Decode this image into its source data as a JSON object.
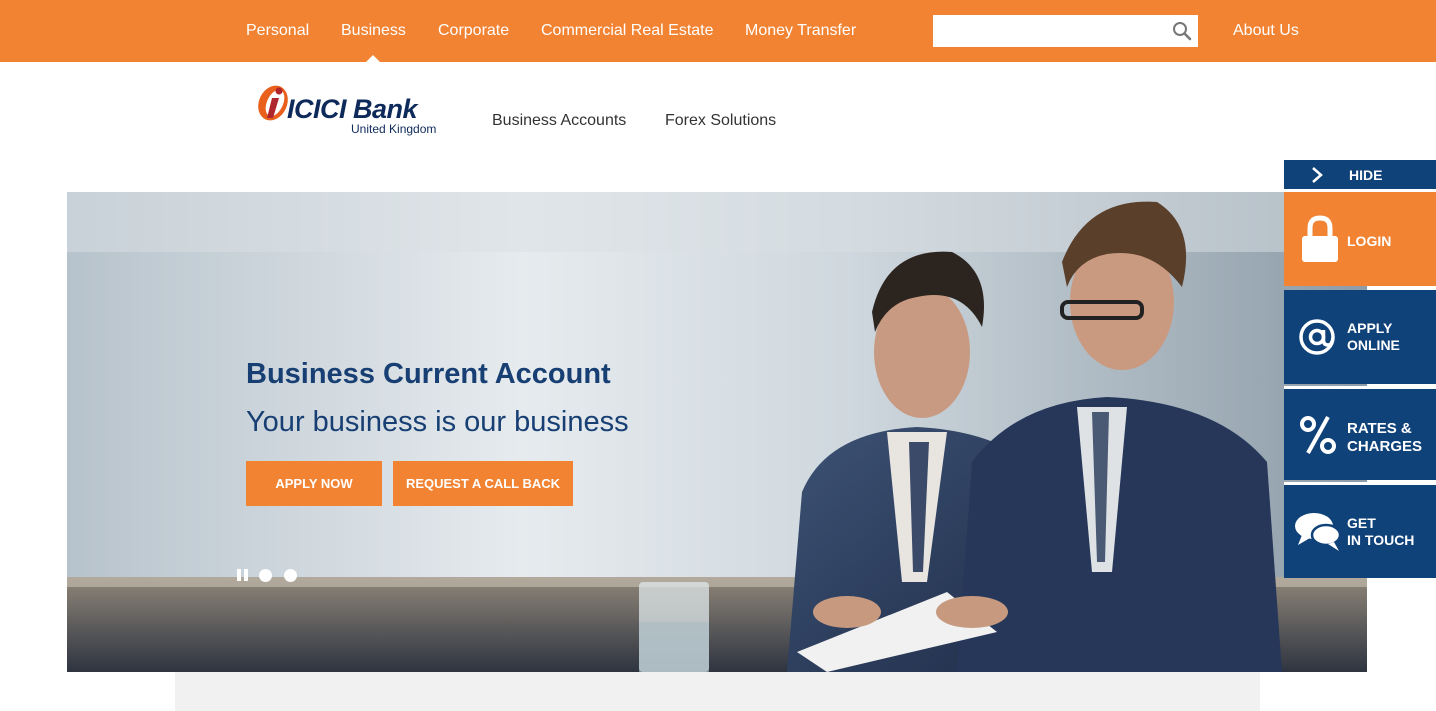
{
  "topnav": {
    "items": [
      {
        "label": "Personal"
      },
      {
        "label": "Business"
      },
      {
        "label": "Corporate"
      },
      {
        "label": "Commercial Real Estate"
      },
      {
        "label": "Money Transfer"
      }
    ],
    "active": "Business",
    "about": "About Us",
    "search_value": ""
  },
  "logo": {
    "brand": "ICICI Bank",
    "sub": "United Kingdom"
  },
  "subnav": {
    "items": [
      {
        "label": "Business Accounts"
      },
      {
        "label": "Forex Solutions"
      }
    ]
  },
  "hero": {
    "title": "Business Current Account",
    "subtitle": "Your business is our business",
    "apply_label": "APPLY NOW",
    "callback_label": "REQUEST A CALL BACK"
  },
  "side_panel": {
    "hide_label": "HIDE",
    "login": "LOGIN",
    "apply_line1": "APPLY",
    "apply_line2": "ONLINE",
    "rates_line1": "RATES &",
    "rates_line2": "CHARGES",
    "touch_line1": "GET",
    "touch_line2": "IN TOUCH"
  },
  "colors": {
    "accent_orange": "#f18333",
    "brand_navy": "#10427a",
    "heading_blue": "#173f73"
  }
}
